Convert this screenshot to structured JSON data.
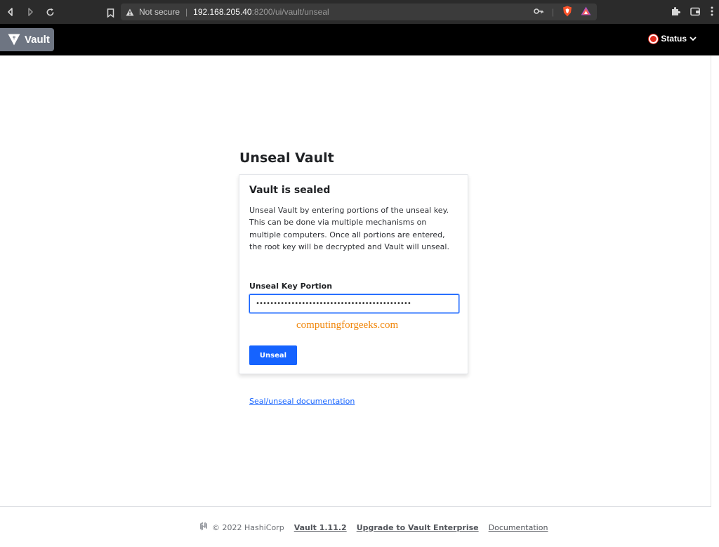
{
  "browser": {
    "security_label": "Not secure",
    "url_host": "192.168.205.40",
    "url_path": ":8200/ui/vault/unseal"
  },
  "header": {
    "brand": "Vault",
    "status_label": "Status",
    "status_color": "#e0281b"
  },
  "main": {
    "title": "Unseal Vault",
    "card": {
      "title": "Vault is sealed",
      "description": "Unseal Vault by entering portions of the unseal key. This can be done via multiple mechanisms on multiple computers. Once all portions are entered, the root key will be decrypted and Vault will unseal.",
      "field_label": "Unseal Key Portion",
      "field_value": "••••••••••••••••••••••••••••••••••••••••••••",
      "watermark": "computingforgeeks.com",
      "submit_label": "Unseal"
    },
    "doc_link": "Seal/unseal documentation"
  },
  "footer": {
    "copyright": "© 2022 HashiCorp",
    "version_link": "Vault 1.11.2",
    "upgrade_link": "Upgrade to Vault Enterprise",
    "docs_link": "Documentation"
  },
  "colors": {
    "accent": "#1563ff",
    "header_bg": "#000000",
    "logo_bg": "#6e7582",
    "watermark": "#f0860a"
  }
}
